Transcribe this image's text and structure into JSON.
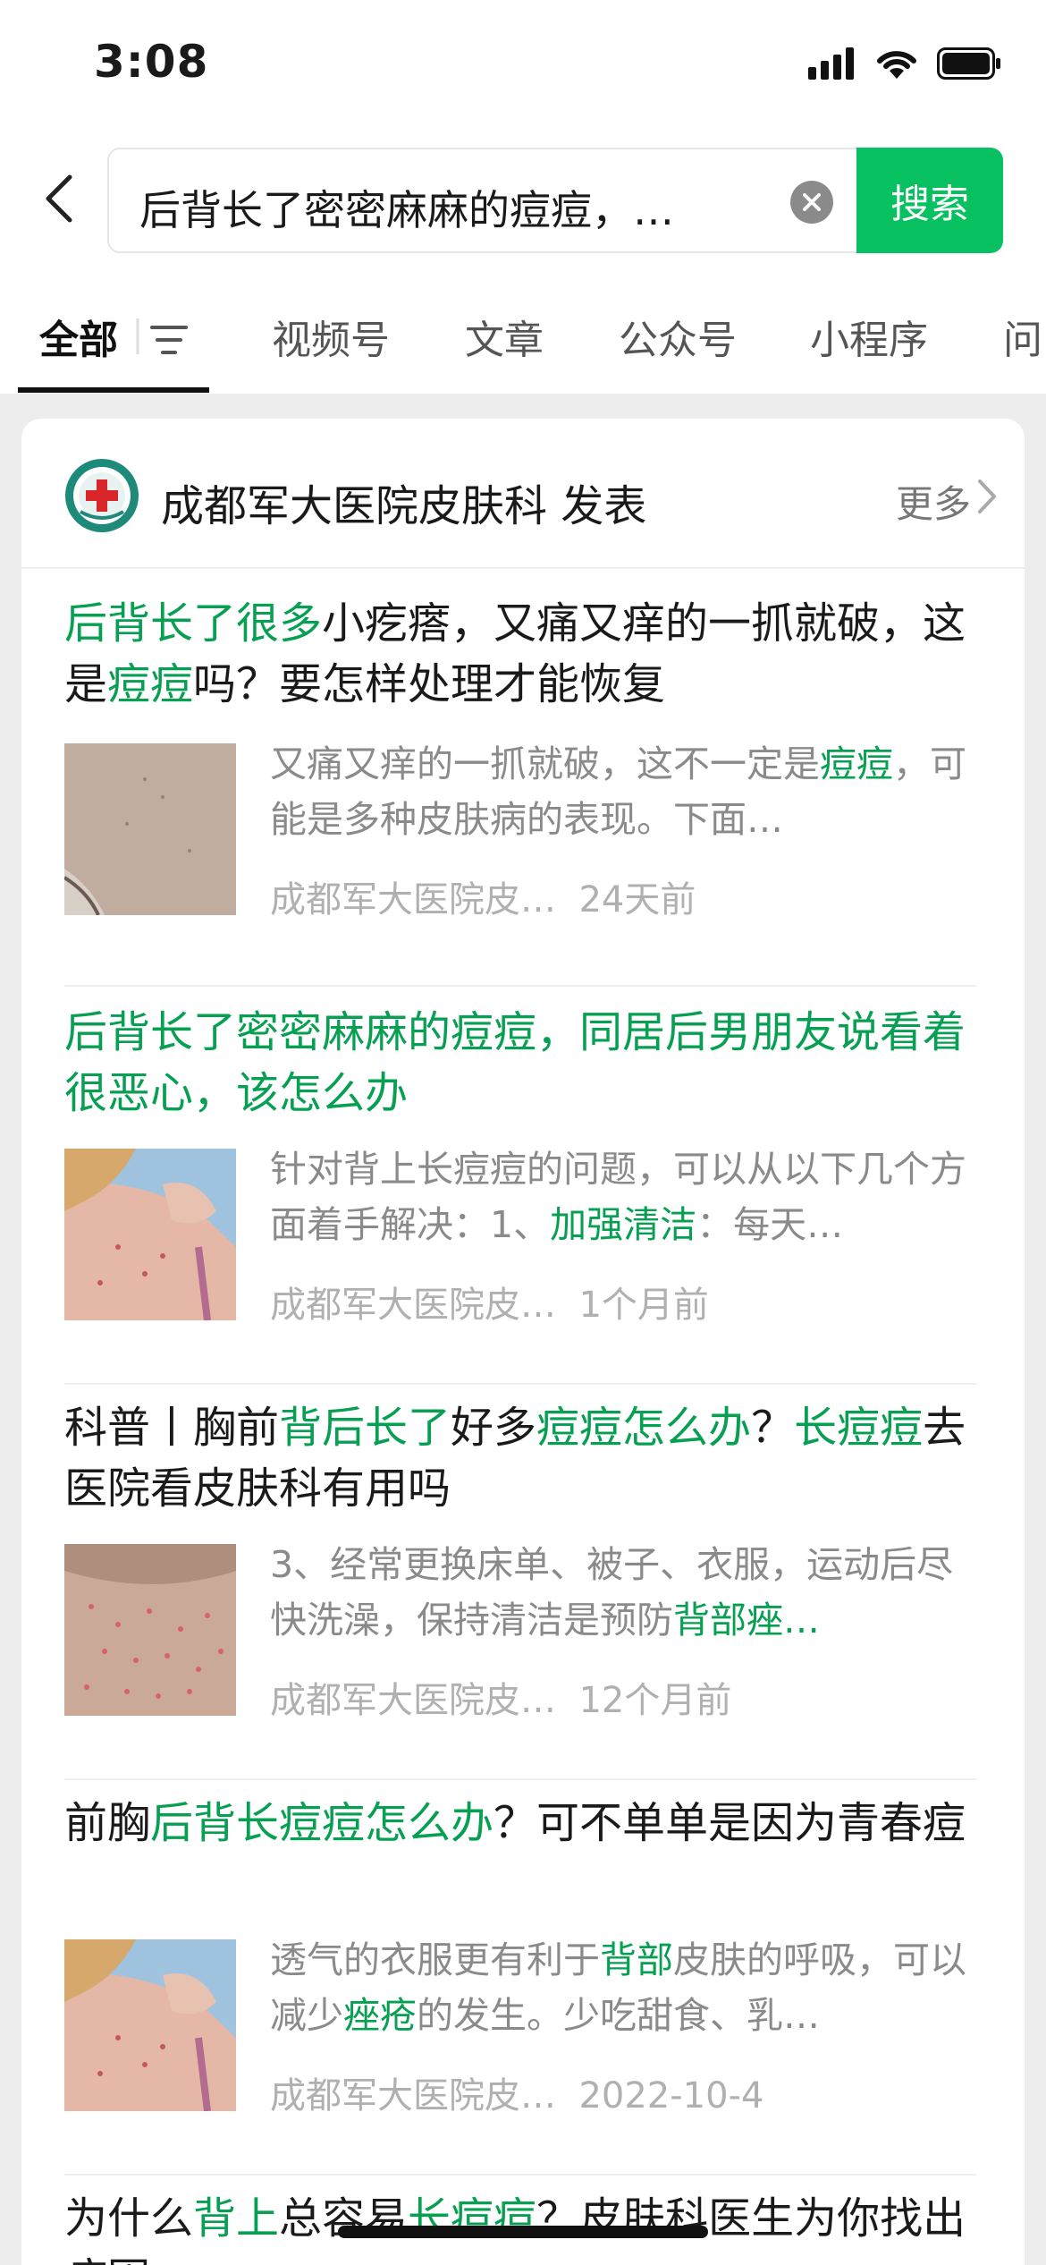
{
  "status_bar": {
    "time": "3:08"
  },
  "search": {
    "query": "后背长了密密麻麻的痘痘，…",
    "button": "搜索"
  },
  "tabs": [
    "全部",
    "视频号",
    "文章",
    "公众号",
    "小程序",
    "问"
  ],
  "account": {
    "name": "成都军大医院皮肤科 发表",
    "more": "更多"
  },
  "results": [
    {
      "title": [
        {
          "t": "后背长了很多",
          "h": true
        },
        {
          "t": "小疙瘩，又痛又痒的一抓就破，这是",
          "h": false
        },
        {
          "t": "痘痘",
          "h": true
        },
        {
          "t": "吗？要怎样处理才能恢复",
          "h": false
        }
      ],
      "snippet": [
        {
          "t": "又痛又痒的一抓就破，这不一定是",
          "h": false
        },
        {
          "t": "痘痘",
          "h": true
        },
        {
          "t": "，可能是多种皮肤病的表现。下面…",
          "h": false
        }
      ],
      "source": "成都军大医院皮…",
      "date": "24天前"
    },
    {
      "title": [
        {
          "t": "后背长了密密麻麻的痘痘，同居后男朋友说看着很恶心，该怎么办",
          "h": true
        }
      ],
      "snippet": [
        {
          "t": "针对背上长痘痘的问题，可以从以下几个方面着手解决：1、",
          "h": false
        },
        {
          "t": "加强清洁",
          "h": true
        },
        {
          "t": "：每天…",
          "h": false
        }
      ],
      "source": "成都军大医院皮…",
      "date": "1个月前"
    },
    {
      "title": [
        {
          "t": "科普丨胸前",
          "h": false
        },
        {
          "t": "背后长了",
          "h": true
        },
        {
          "t": "好多",
          "h": false
        },
        {
          "t": "痘痘怎么办",
          "h": true
        },
        {
          "t": "？",
          "h": false
        },
        {
          "t": "长痘痘",
          "h": true
        },
        {
          "t": "去医院看皮肤科有用吗",
          "h": false
        }
      ],
      "snippet": [
        {
          "t": "3、经常更换床单、被子、衣服，运动后尽快洗澡，保持清洁是预防",
          "h": false
        },
        {
          "t": "背部痤…",
          "h": true
        }
      ],
      "source": "成都军大医院皮…",
      "date": "12个月前"
    },
    {
      "title": [
        {
          "t": "前胸",
          "h": false
        },
        {
          "t": "后背长痘痘怎么办",
          "h": true
        },
        {
          "t": "？可不单单是因为青春痘",
          "h": false
        }
      ],
      "snippet": [
        {
          "t": "透气的衣服更有利于",
          "h": false
        },
        {
          "t": "背部",
          "h": true
        },
        {
          "t": "皮肤的呼吸，可以减少",
          "h": false
        },
        {
          "t": "痤疮",
          "h": true
        },
        {
          "t": "的发生。少吃甜食、乳…",
          "h": false
        }
      ],
      "source": "成都军大医院皮…",
      "date": "2022-10-4"
    },
    {
      "title": [
        {
          "t": "为什么",
          "h": false
        },
        {
          "t": "背上",
          "h": true
        },
        {
          "t": "总容易",
          "h": false
        },
        {
          "t": "长痘痘",
          "h": true
        },
        {
          "t": "？皮肤科医生为你找出病因",
          "h": false
        }
      ],
      "snippet": [],
      "source": "",
      "date": ""
    }
  ],
  "colors": {
    "accent": "#07c160",
    "highlight": "#07a052"
  }
}
